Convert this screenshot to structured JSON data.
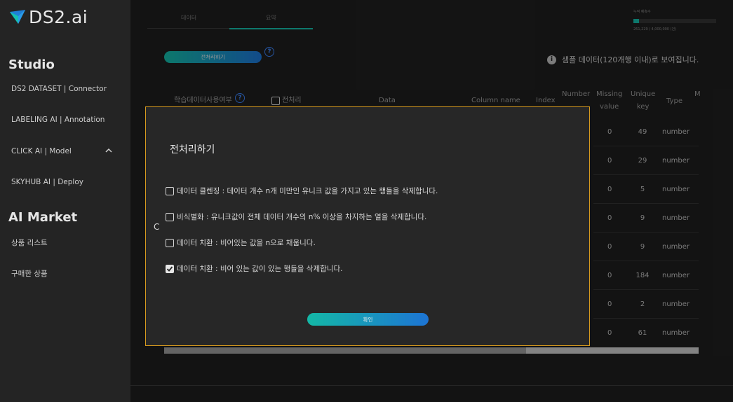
{
  "brand": {
    "logo_text": "DS2.ai"
  },
  "sidebar": {
    "studio_title": "Studio",
    "studio_items": [
      {
        "label": "DS2 DATASET | Connector"
      },
      {
        "label": "LABELING AI | Annotation"
      },
      {
        "label": "CLICK AI | Model"
      },
      {
        "label": "SKYHUB AI | Deploy"
      }
    ],
    "market_title": "AI Market",
    "market_items": [
      {
        "label": "상품 리스트"
      },
      {
        "label": "구매한 상품"
      }
    ]
  },
  "tabs": [
    {
      "label": "데이터"
    },
    {
      "label": "요약"
    }
  ],
  "usage": {
    "label": "누적 예측수",
    "value_text": "261,229 / 4,000,000 (건)",
    "fraction": 0.065
  },
  "toolbar": {
    "preprocess_label": "전처리하기",
    "help": "?"
  },
  "info": {
    "icon": "i",
    "text": "샘플 데이터(120개행 이내)로 보여집니다."
  },
  "table": {
    "headers": {
      "use": "학습데이터사용여부",
      "preprocess": "전처리",
      "data": "Data",
      "column": "Column name",
      "index": "Index",
      "number": "Number",
      "missing": [
        "Missing",
        "value"
      ],
      "unique": [
        "Unique",
        "key"
      ],
      "type": "Type",
      "more": "M"
    },
    "rows": [
      {
        "missing": "0",
        "unique": "49",
        "type": "number"
      },
      {
        "missing": "0",
        "unique": "29",
        "type": "number"
      },
      {
        "missing": "0",
        "unique": "5",
        "type": "number"
      },
      {
        "missing": "0",
        "unique": "9",
        "type": "number"
      },
      {
        "missing": "0",
        "unique": "9",
        "type": "number"
      },
      {
        "missing": "0",
        "unique": "184",
        "type": "number"
      },
      {
        "missing": "0",
        "unique": "2",
        "type": "number"
      },
      {
        "missing": "0",
        "unique": "61",
        "type": "number"
      }
    ]
  },
  "modal": {
    "title": "전처리하기",
    "options": [
      {
        "label": "데이터 클렌징 : 데이터 개수 n개 미만인 유니크 값을 가지고 있는 행들을 삭제합니다.",
        "checked": false
      },
      {
        "label": "비식별화 : 유니크값이 전체 데이터 개수의 n% 이상을 차지하는 열을 삭제합니다.",
        "checked": false
      },
      {
        "label": "데이터 치환 : 비어있는 값을 n으로 채웁니다.",
        "checked": false
      },
      {
        "label": "데이터 치환 : 비어 있는 값이 있는 행들을 삭제합니다.",
        "checked": true
      }
    ],
    "confirm_label": "확인"
  },
  "stray_char": "C",
  "colors": {
    "accent_teal": "#14b8a6",
    "accent_blue": "#1d74d4",
    "modal_border": "#d79a1e"
  }
}
